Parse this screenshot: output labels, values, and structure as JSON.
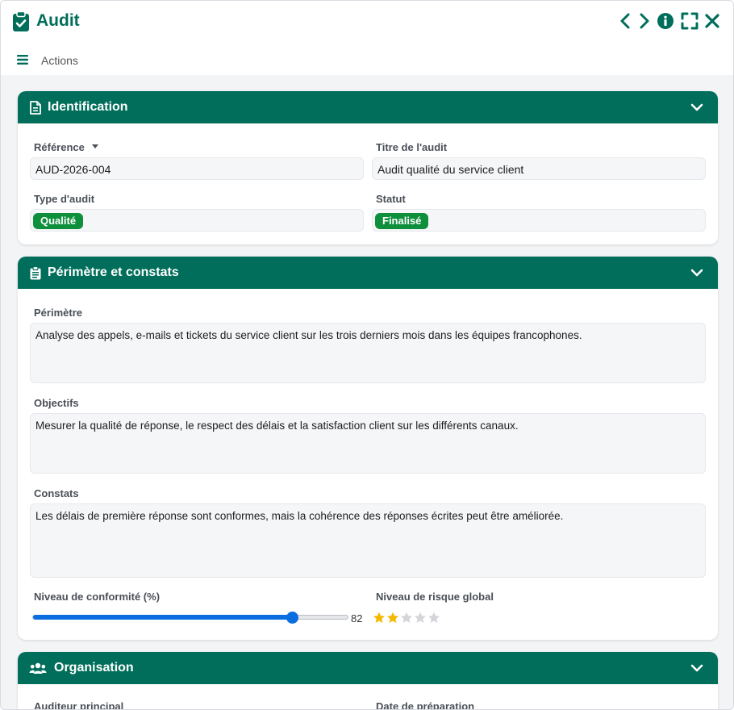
{
  "window": {
    "title": "Audit"
  },
  "toolbar": {
    "actions_label": "Actions"
  },
  "sections": {
    "identification": {
      "title": "Identification",
      "reference_label": "Référence",
      "reference_value": "AUD-2026-004",
      "titre_label": "Titre de l'audit",
      "titre_value": "Audit qualité du service client",
      "type_label": "Type d'audit",
      "type_value": "Qualité",
      "statut_label": "Statut",
      "statut_value": "Finalisé"
    },
    "perimetre": {
      "title": "Périmètre et constats",
      "perimetre_label": "Périmètre",
      "perimetre_value": "Analyse des appels, e-mails et tickets du service client sur les trois derniers mois dans les équipes francophones.",
      "objectifs_label": "Objectifs",
      "objectifs_value": "Mesurer la qualité de réponse, le respect des délais et la satisfaction client sur les différents canaux.",
      "constats_label": "Constats",
      "constats_value": "Les délais de première réponse sont conformes, mais la cohérence des réponses écrites peut être améliorée.",
      "conformite_label": "Niveau de conformité (%)",
      "conformite_value": 82,
      "conformite_text": "82",
      "risque_label": "Niveau de risque global",
      "risque_rating": 2,
      "risque_max": 5
    },
    "organisation": {
      "title": "Organisation",
      "auditeur_label": "Auditeur principal",
      "date_label": "Date de préparation"
    }
  },
  "colors": {
    "primary": "#006e5a",
    "badge_green": "#0d8f3c",
    "slider_blue": "#0a6ee0",
    "star_filled": "#f5b800",
    "star_empty": "#d3d5d9"
  },
  "icons": {
    "app": "clipboard-check-icon",
    "prev": "chevron-left-icon",
    "next": "chevron-right-icon",
    "info": "info-icon",
    "expand": "expand-icon",
    "close": "close-icon",
    "menu": "menu-icon",
    "identification": "document-icon",
    "perimetre": "clipboard-list-icon",
    "organisation": "users-icon"
  }
}
